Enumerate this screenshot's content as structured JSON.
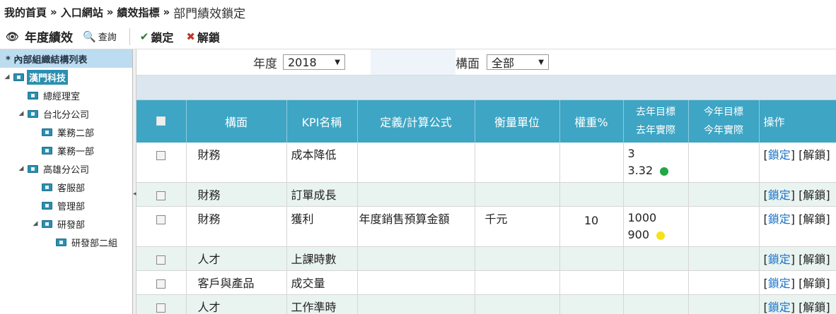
{
  "breadcrumb": {
    "items": [
      "我的首頁",
      "入口網站",
      "績效指標"
    ],
    "separator": "»",
    "current": "部門績效鎖定"
  },
  "toolbar": {
    "title": "年度績效",
    "search_label": "查詢",
    "lock_label": "鎖定",
    "unlock_label": "解鎖"
  },
  "sidebar": {
    "header": "* 內部組織結構列表",
    "tree": [
      {
        "label": "漢門科技",
        "level": 0,
        "expanded": true,
        "selected": true
      },
      {
        "label": "總經理室",
        "level": 1,
        "expanded": false,
        "selected": false
      },
      {
        "label": "台北分公司",
        "level": 1,
        "expanded": true,
        "selected": false
      },
      {
        "label": "業務二部",
        "level": 2,
        "expanded": false,
        "selected": false
      },
      {
        "label": "業務一部",
        "level": 2,
        "expanded": false,
        "selected": false
      },
      {
        "label": "高雄分公司",
        "level": 1,
        "expanded": true,
        "selected": false
      },
      {
        "label": "客服部",
        "level": 2,
        "expanded": false,
        "selected": false
      },
      {
        "label": "管理部",
        "level": 2,
        "expanded": false,
        "selected": false
      },
      {
        "label": "研發部",
        "level": 2,
        "expanded": true,
        "selected": false
      },
      {
        "label": "研發部二組",
        "level": 3,
        "expanded": false,
        "selected": false
      }
    ]
  },
  "filters": {
    "year_label": "年度",
    "year_value": "2018",
    "dimension_label": "構面",
    "dimension_value": "全部"
  },
  "table": {
    "headers": {
      "dimension": "構面",
      "kpi": "KPI名稱",
      "definition": "定義/計算公式",
      "unit": "衡量單位",
      "weight": "權重%",
      "last_target": "去年目標",
      "last_actual": "去年實際",
      "this_target": "今年目標",
      "this_actual": "今年實際",
      "ops": "操作"
    },
    "op_lock": "鎖定",
    "op_unlock": "解鎖",
    "rows": [
      {
        "dimension": "財務",
        "kpi": "成本降低",
        "definition": "",
        "unit": "",
        "weight": "",
        "last_target": "3",
        "last_actual": "3.32",
        "status": "green"
      },
      {
        "dimension": "財務",
        "kpi": "訂單成長",
        "definition": "",
        "unit": "",
        "weight": "",
        "last_target": "",
        "last_actual": "",
        "status": ""
      },
      {
        "dimension": "財務",
        "kpi": "獲利",
        "definition": "年度銷售預算金額",
        "unit": "千元",
        "weight": "10",
        "last_target": "1000",
        "last_actual": "900",
        "status": "yellow"
      },
      {
        "dimension": "人才",
        "kpi": "上課時數",
        "definition": "",
        "unit": "",
        "weight": "",
        "last_target": "",
        "last_actual": "",
        "status": ""
      },
      {
        "dimension": "客戶與產品",
        "kpi": "成交量",
        "definition": "",
        "unit": "",
        "weight": "",
        "last_target": "",
        "last_actual": "",
        "status": ""
      },
      {
        "dimension": "人才",
        "kpi": "工作準時",
        "definition": "",
        "unit": "",
        "weight": "",
        "last_target": "",
        "last_actual": "",
        "status": ""
      }
    ]
  },
  "colors": {
    "header_bg": "#3ea5c4",
    "status_green": "#22a745",
    "status_yellow": "#f5e21a",
    "link": "#1a73c9"
  }
}
